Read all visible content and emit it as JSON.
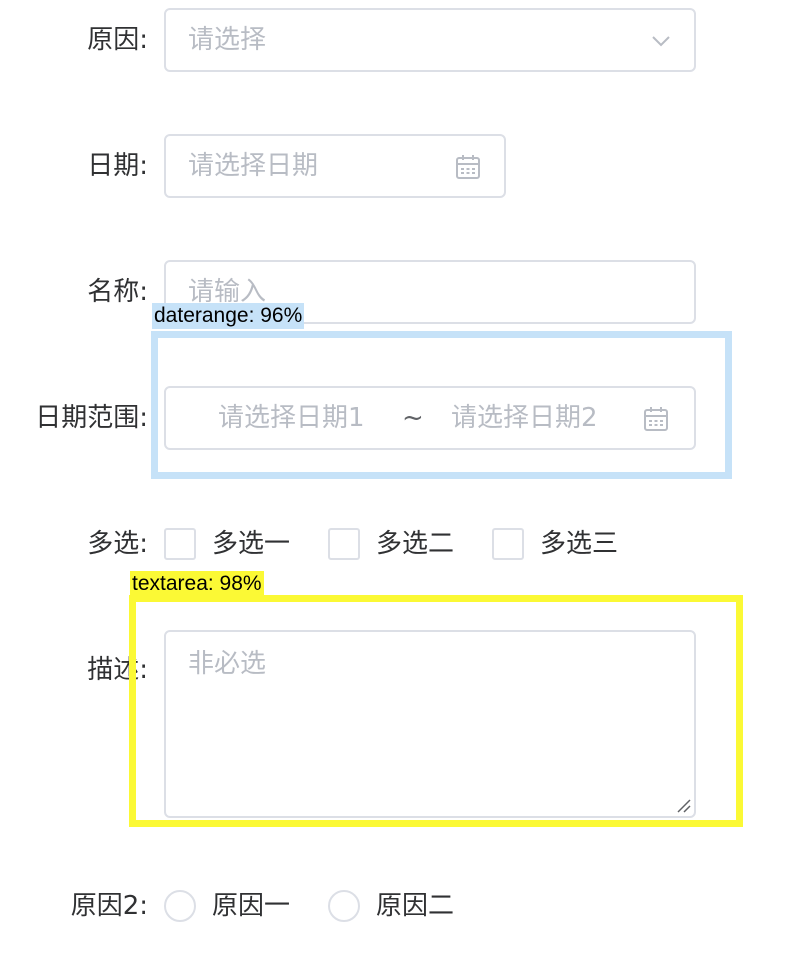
{
  "form": {
    "reason": {
      "label": "原因:",
      "placeholder": "请选择",
      "icon": "chevron-down-icon"
    },
    "date": {
      "label": "日期:",
      "placeholder": "请选择日期",
      "icon": "calendar-icon"
    },
    "name": {
      "label": "名称:",
      "placeholder": "请输入"
    },
    "daterange": {
      "label": "日期范围:",
      "start_placeholder": "请选择日期1",
      "separator": "~",
      "end_placeholder": "请选择日期2",
      "icon": "calendar-icon"
    },
    "multi": {
      "label": "多选:",
      "options": [
        "多选一",
        "多选二",
        "多选三"
      ]
    },
    "description": {
      "label": "描述:",
      "placeholder": "非必选"
    },
    "reason2": {
      "label": "原因2:",
      "options": [
        "原因一",
        "原因二"
      ]
    }
  },
  "annotations": [
    {
      "text": "daterange: 96%",
      "color": "#c6e2f8"
    },
    {
      "text": "textarea: 98%",
      "color": "#fbf935"
    }
  ]
}
